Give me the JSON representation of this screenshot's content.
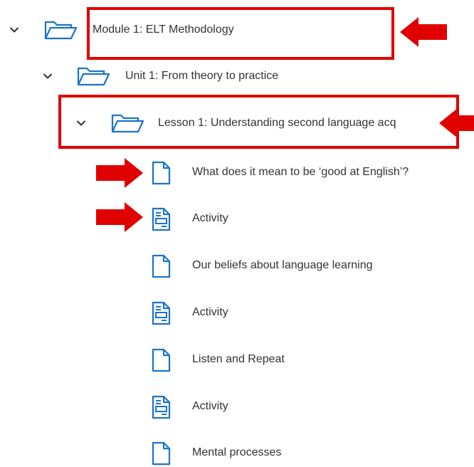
{
  "accent_color": "#1a73c9",
  "annotation_color": "#e00000",
  "tree": {
    "module": {
      "label": "Module 1: ELT Methodology",
      "icon": "folder-open-icon",
      "expanded": true
    },
    "unit": {
      "label": "Unit 1: From theory to practice",
      "icon": "folder-open-icon",
      "expanded": true
    },
    "lesson": {
      "label": "Lesson 1: Understanding second language acq",
      "icon": "folder-open-icon",
      "expanded": true
    },
    "items": [
      {
        "label": "What does it mean to be ‘good at English’?",
        "icon": "page-icon"
      },
      {
        "label": "Activity",
        "icon": "activity-icon"
      },
      {
        "label": "Our beliefs about language learning",
        "icon": "page-icon"
      },
      {
        "label": "Activity",
        "icon": "activity-icon"
      },
      {
        "label": "Listen and Repeat",
        "icon": "page-icon"
      },
      {
        "label": "Activity",
        "icon": "activity-icon"
      },
      {
        "label": "Mental processes",
        "icon": "page-icon"
      }
    ]
  }
}
